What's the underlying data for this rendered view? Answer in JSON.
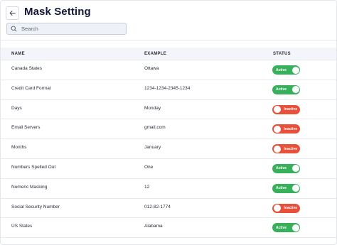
{
  "header": {
    "title": "Mask Setting",
    "back_icon": "arrow-left-icon"
  },
  "search": {
    "placeholder": "Search",
    "value": "",
    "icon": "search-icon"
  },
  "table": {
    "columns": [
      "NAME",
      "EXAMPLE",
      "STATUS"
    ],
    "rows": [
      {
        "name": "Canada States",
        "example": "Ottawa",
        "status": "Active"
      },
      {
        "name": "Credit Card Format",
        "example": "1234-1234-2345-1234",
        "status": "Active"
      },
      {
        "name": "Days",
        "example": "Monday",
        "status": "Inactive"
      },
      {
        "name": "Email Servers",
        "example": "gmail.com",
        "status": "Inactive"
      },
      {
        "name": "Months",
        "example": "January",
        "status": "Inactive"
      },
      {
        "name": "Numbers Spelled Out",
        "example": "One",
        "status": "Active"
      },
      {
        "name": "Numeric Masking",
        "example": "12",
        "status": "Active"
      },
      {
        "name": "Social Security Number",
        "example": "012-82-1774",
        "status": "Inactive"
      },
      {
        "name": "US States",
        "example": "Alabama",
        "status": "Active"
      }
    ]
  },
  "colors": {
    "active": "#36b05a",
    "inactive": "#e8503a",
    "title": "#14183a"
  }
}
